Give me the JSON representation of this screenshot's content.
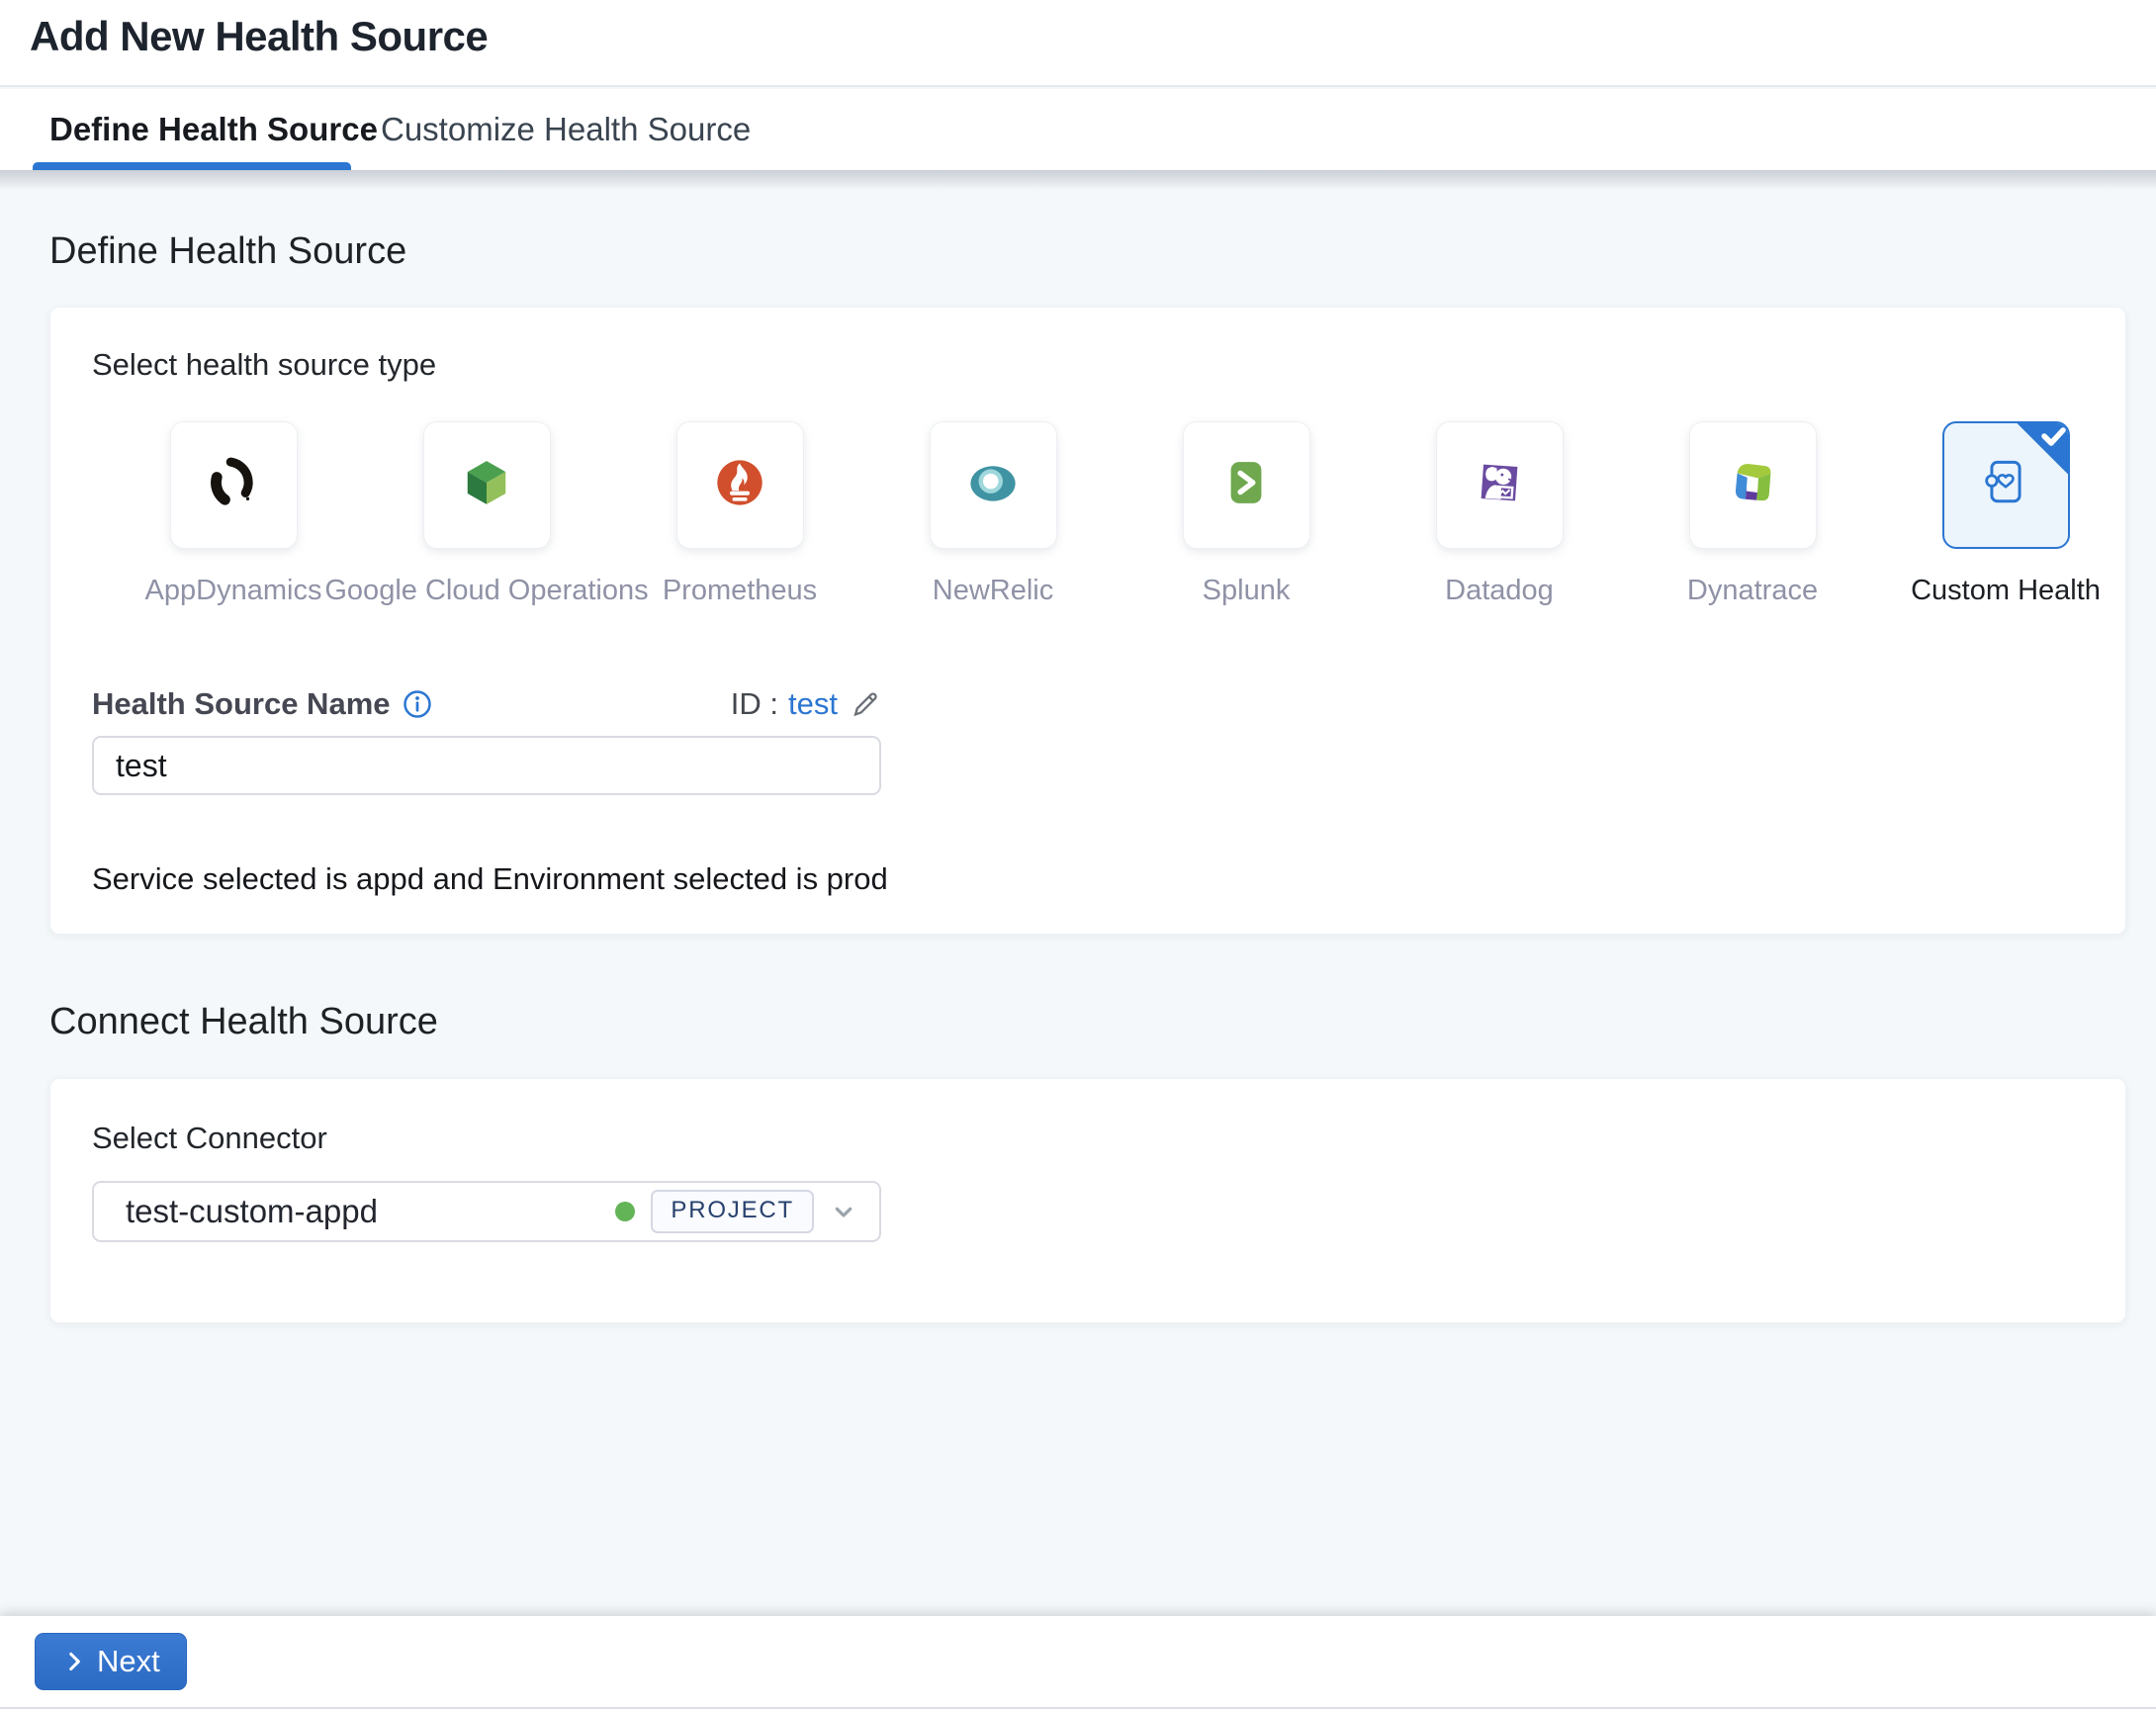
{
  "header": {
    "title": "Add New Health Source"
  },
  "tabs": [
    {
      "label": "Define Health Source",
      "active": true
    },
    {
      "label": "Customize Health Source",
      "active": false
    }
  ],
  "define_section": {
    "heading": "Define Health Source",
    "select_type_label": "Select health source type",
    "sources": [
      {
        "label": "AppDynamics",
        "selected": false
      },
      {
        "label": "Google Cloud Operations",
        "selected": false
      },
      {
        "label": "Prometheus",
        "selected": false
      },
      {
        "label": "NewRelic",
        "selected": false
      },
      {
        "label": "Splunk",
        "selected": false
      },
      {
        "label": "Datadog",
        "selected": false
      },
      {
        "label": "Dynatrace",
        "selected": false
      },
      {
        "label": "Custom Health",
        "selected": true
      }
    ],
    "name_field": {
      "label": "Health Source Name",
      "value": "test",
      "id_prefix": "ID :",
      "id_value": "test"
    },
    "service_note": "Service selected is appd and Environment selected is prod"
  },
  "connect_section": {
    "heading": "Connect Health Source",
    "select_connector_label": "Select Connector",
    "connector": {
      "name": "test-custom-appd",
      "scope_badge": "PROJECT",
      "status_color": "#63b457"
    }
  },
  "footer": {
    "next_label": "Next"
  },
  "colors": {
    "accent_blue": "#2b76d2",
    "selected_tile_bg": "#ecf5fc",
    "page_background": "#f4f8fa",
    "link_blue": "#2b76d2",
    "icon_label_gray": "#8f92a6"
  }
}
